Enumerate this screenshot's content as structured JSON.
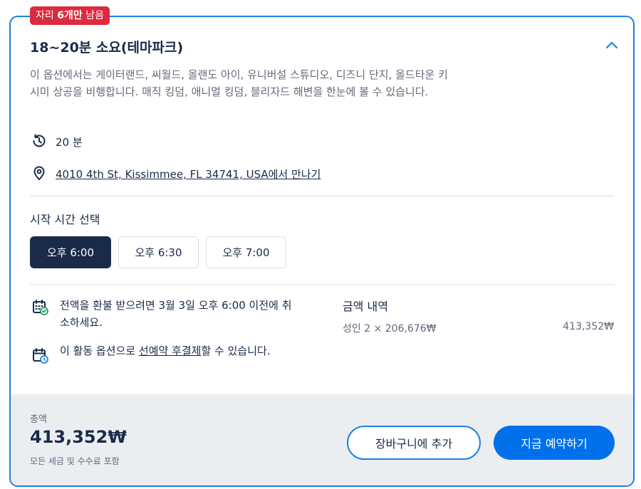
{
  "badge": {
    "prefix": "자리",
    "count": "6개만",
    "suffix": "남음"
  },
  "option": {
    "title": "18~20분 소요(테마파크)",
    "description": "이 옵션에서는 게이터랜드, 씨월드, 올랜도 아이, 유니버설 스튜디오, 디즈니 단지, 올드타운 키시미 상공을 비행합니다. 매직 킹덤, 애니멀 킹덤, 블리자드 해변을 한눈에 볼 수 있습니다.",
    "duration": "20 분",
    "address": "4010 4th St, Kissimmee, FL 34741, USA에서 만나기"
  },
  "start_time": {
    "label": "시작 시간 선택",
    "slots": [
      "오후 6:00",
      "오후 6:30",
      "오후 7:00"
    ],
    "selected_index": 0
  },
  "refund": {
    "text": "전액을 환불 받으려면 3월 3일 오후 6:00 이전에 취소하세요."
  },
  "pay_later": {
    "before": "이 활동 옵션으로 ",
    "link": "선예약 후결제",
    "after": "할 수 있습니다."
  },
  "price": {
    "title": "금액 내역",
    "line_label": "성인 2 × 206,676₩",
    "line_amount": "413,352₩"
  },
  "footer": {
    "total_label": "총액",
    "total_amount": "413,352₩",
    "total_note": "모든 세금 및 수수료 포함",
    "cart_button": "장바구니에 추가",
    "book_button": "지금 예약하기"
  },
  "colors": {
    "accent": "#1e7fe0",
    "primary_button": "#0071eb",
    "badge": "#dc2a3e",
    "navy": "#1a2b49",
    "footer_bg": "#ebeef1"
  },
  "icons": {
    "collapse": "chevron-up-icon",
    "duration": "clock-history-icon",
    "location": "location-pin-icon",
    "refund": "calendar-check-icon",
    "pay_later": "calendar-clock-icon"
  }
}
